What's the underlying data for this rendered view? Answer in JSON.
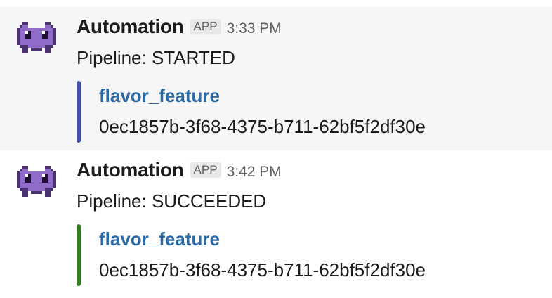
{
  "messages": [
    {
      "sender": "Automation",
      "badge": "APP",
      "time": "3:33 PM",
      "text": "Pipeline: STARTED",
      "attachment": {
        "color": "#3f51a8",
        "title": "flavor_feature",
        "text": "0ec1857b-3f68-4375-b711-62bf5f2df30e"
      }
    },
    {
      "sender": "Automation",
      "badge": "APP",
      "time": "3:42 PM",
      "text": "Pipeline: SUCCEEDED",
      "attachment": {
        "color": "#2e7d1e",
        "title": "flavor_feature",
        "text": "0ec1857b-3f68-4375-b711-62bf5f2df30e"
      }
    }
  ],
  "avatar_icon": "space-invader-icon",
  "colors": {
    "avatar": "#8e6cc8",
    "avatar_dark": "#4a3370",
    "link": "#2b6aa5",
    "highlight_bg": "#f6f6f6"
  }
}
